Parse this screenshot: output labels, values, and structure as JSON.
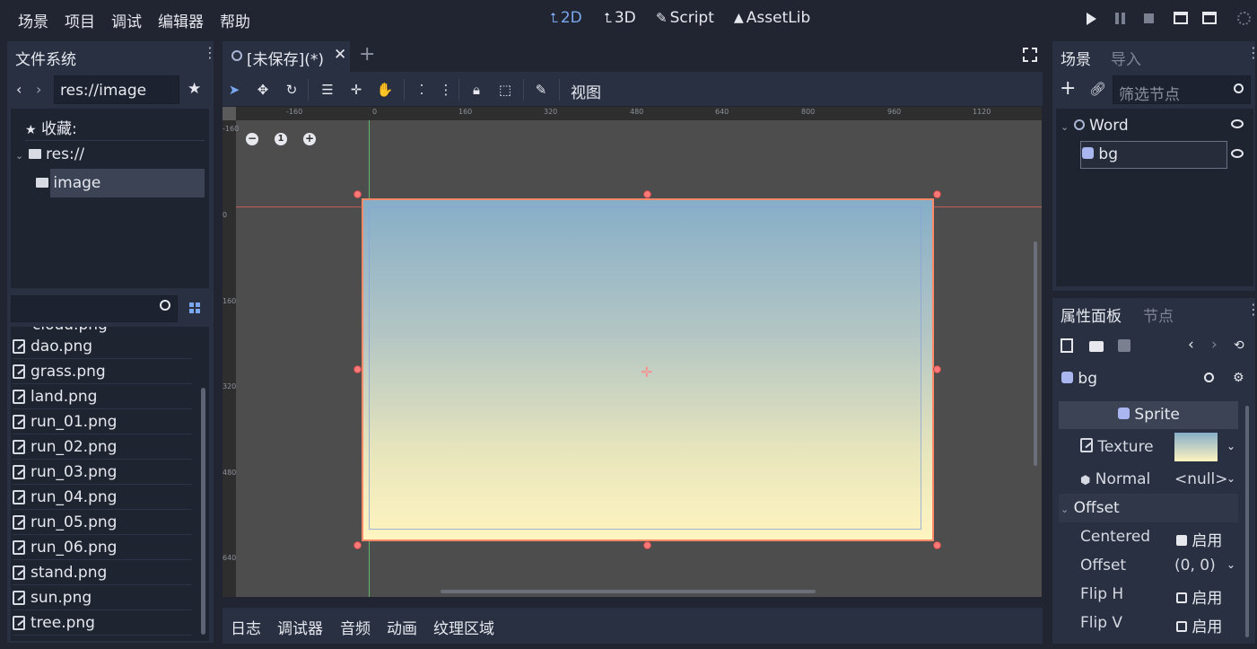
{
  "menu": [
    "场景",
    "项目",
    "调试",
    "编辑器",
    "帮助"
  ],
  "workspaces": [
    {
      "label": "2D",
      "icon": "2d-icon"
    },
    {
      "label": "3D",
      "icon": "3d-icon"
    },
    {
      "label": "Script",
      "icon": "script-icon"
    },
    {
      "label": "AssetLib",
      "icon": "assetlib-icon"
    }
  ],
  "filesystem": {
    "tab": "文件系统",
    "path": "res://image",
    "favorites": "收藏:",
    "root": "res://",
    "selected_folder": "image",
    "files": [
      "dao.png",
      "grass.png",
      "land.png",
      "run_01.png",
      "run_02.png",
      "run_03.png",
      "run_04.png",
      "run_05.png",
      "run_06.png",
      "stand.png",
      "sun.png",
      "tree.png"
    ],
    "partial_file": "cloud.png"
  },
  "editor": {
    "scene_tab": "[未保存](*)",
    "view_menu": "视图",
    "ruler_labels": [
      "-160",
      "0",
      "160",
      "320",
      "480",
      "640",
      "800",
      "960",
      "1120"
    ],
    "vruler_labels": [
      "-160",
      "0",
      "160",
      "320",
      "480",
      "640"
    ],
    "zoom_reset": "1"
  },
  "bottom_tabs": [
    "日志",
    "调试器",
    "音频",
    "动画",
    "纹理区域"
  ],
  "scene": {
    "tab_active": "场景",
    "tab_inactive": "导入",
    "filter_placeholder": "筛选节点",
    "nodes": [
      {
        "name": "Word",
        "icon": "node2d-icon"
      },
      {
        "name": "bg",
        "icon": "sprite-icon"
      }
    ]
  },
  "inspector": {
    "tab_active": "属性面板",
    "tab_inactive": "节点",
    "object": "bg",
    "class_header": "Sprite",
    "properties": {
      "texture": "Texture",
      "normal": "Normal",
      "normal_value": "<null>",
      "offset_section": "Offset",
      "centered": "Centered",
      "centered_value": "启用",
      "offset": "Offset",
      "offset_value": "(0, 0)",
      "flip_h": "Flip H",
      "flip_h_value": "启用",
      "flip_v": "Flip V",
      "flip_v_value": "启用"
    }
  },
  "colors": {
    "accent": "#7aa7f0",
    "background": "#202531",
    "panel": "#283042",
    "canvas": "#4d4d4d",
    "sky_top": "#86aec8",
    "sky_bottom": "#fff4c0",
    "selection": "#ff8a6a"
  }
}
